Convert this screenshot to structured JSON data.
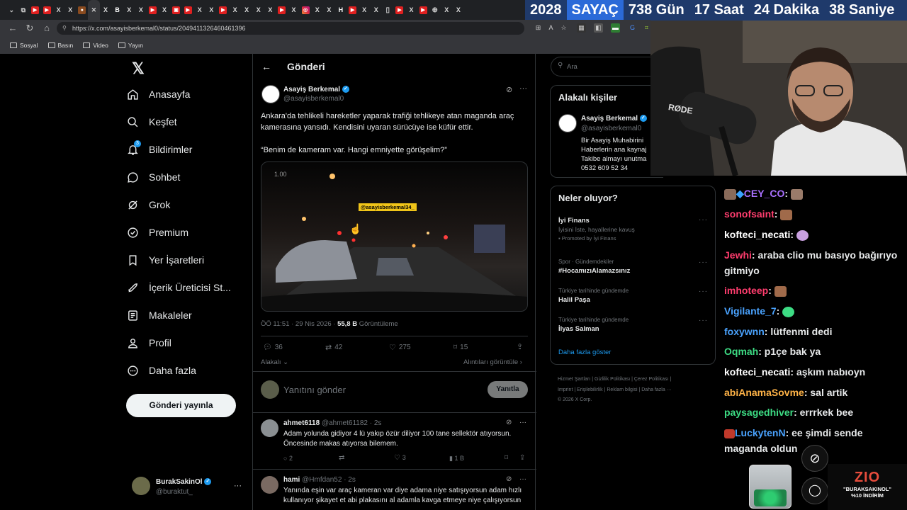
{
  "browser": {
    "url": "https://x.com/asayisberkemal0/status/2049411326460461396",
    "bookmarks": [
      "Sosyal",
      "Basın",
      "Video",
      "Yayın"
    ]
  },
  "counter": {
    "year": "2028",
    "label": "SAYAÇ",
    "days": "738 Gün",
    "hours": "17 Saat",
    "minutes": "24 Dakika",
    "seconds": "38 Saniye"
  },
  "sidebar": {
    "items": [
      {
        "label": "Anasayfa",
        "icon": "home-icon"
      },
      {
        "label": "Keşfet",
        "icon": "search-icon"
      },
      {
        "label": "Bildirimler",
        "icon": "bell-icon",
        "badge": "3"
      },
      {
        "label": "Sohbet",
        "icon": "chat-icon"
      },
      {
        "label": "Grok",
        "icon": "grok-icon"
      },
      {
        "label": "Premium",
        "icon": "premium-icon"
      },
      {
        "label": "Yer İşaretleri",
        "icon": "bookmark-icon"
      },
      {
        "label": "İçerik Üreticisi St...",
        "icon": "rocket-icon"
      },
      {
        "label": "Makaleler",
        "icon": "article-icon"
      },
      {
        "label": "Profil",
        "icon": "profile-icon"
      },
      {
        "label": "Daha fazla",
        "icon": "more-icon"
      }
    ],
    "post_button": "Gönderi yayınla",
    "account": {
      "name": "BurakSakinOl",
      "handle": "@buraktut_"
    }
  },
  "post": {
    "header_title": "Gönderi",
    "author": "Asayiş Berkemal",
    "handle": "@asayisberkemal0",
    "text1": "Ankara'da tehlikeli hareketler yaparak trafiği tehlikeye atan maganda araç kamerasına yansıdı. Kendisini uyaran sürücüye ise küfür ettir.",
    "text2": "“Benim de kameram var. Hangi emniyette görüşelim?”",
    "video_timestamp": "1.00",
    "video_watermark": "@asayisberkemal34_",
    "meta_time": "ÖÖ 11:51 · 29 Nis 2026 · ",
    "meta_views": "55,8 B",
    "meta_views_label": " Görüntüleme",
    "replies": "36",
    "reposts": "42",
    "likes": "275",
    "bookmarks": "15",
    "sort_label": "Alakalı",
    "quotes_label": "Alıntıları görüntüle",
    "reply_placeholder": "Yanıtını gönder",
    "reply_button": "Yanıtla"
  },
  "replies": [
    {
      "name": "ahmet6118",
      "handle": "@ahmet61182 · 2s",
      "text1": "Adam yolunda gidiyor 4 lü yakıp özür diliyor 100 tane sellektör atıyorsun.",
      "text2": "Öncesinde makas atıyorsa bilemem.",
      "replies": "2",
      "likes": "3",
      "views": "1 B"
    },
    {
      "name": "hami",
      "handle": "@Hmfdan52 · 2s",
      "text1": "Yanında eşin var araç kameran var diye adama niye satışıyorsun adam hızlı",
      "text2": "kullanıyor şikayet et abi plakasını al adamla kavga etmeye niye çalışıyorsun"
    }
  ],
  "right": {
    "search_placeholder": "Ara",
    "related_title": "Alakalı kişiler",
    "related": {
      "name": "Asayiş Berkemal",
      "handle": "@asayisberkemal0",
      "bio1": "Bir Asayiş Muhabirini",
      "bio2": "Haberlerin ana kaynaj",
      "bio3": "Takibe almayı unutma",
      "bio4": "0532 609 52 34"
    },
    "trends_title": "Neler oluyor?",
    "trends": [
      {
        "name": "İyi Finans",
        "sub": "İyisini İste, hayallerine kavuş",
        "promo": "Promoted by İyi Finans"
      },
      {
        "cat": "Spor · Gündemdekiler",
        "name": "#HocamızıAlamazsınız"
      },
      {
        "cat": "Türkiye tarihinde gündemde",
        "name": "Halil Paşa"
      },
      {
        "cat": "Türkiye tarihinde gündemde",
        "name": "İlyas Salman"
      }
    ],
    "show_more": "Daha fazla göster",
    "footer1": "Hizmet Şartları  |  Gizlilik Politikası  |  Çerez Politikası  |",
    "footer2": "Imprint  |  Erişilebilirlik  |  Reklam bilgisi  |  Daha fazla ···",
    "footer3": "© 2026 X Corp."
  },
  "webcam": {
    "mic_brand": "RØDE"
  },
  "chat": [
    {
      "user": "CEY_CO",
      "msg": "",
      "color": "#a970ff"
    },
    {
      "user": "sonofsaint",
      "msg": "",
      "color": "#ff3d6e"
    },
    {
      "user": "kofteci_necati",
      "msg": "",
      "color": "#ffffff"
    },
    {
      "user": "Jewhi",
      "msg": "araba clio mu basıyo bağırıyo gitmiyo",
      "color": "#ff3d6e"
    },
    {
      "user": "imhoteep",
      "msg": "",
      "color": "#ff3d6e"
    },
    {
      "user": "Vigilante_7",
      "msg": "",
      "color": "#4aa3ff"
    },
    {
      "user": "foxywnn",
      "msg": "lütfenmi dedi",
      "color": "#4aa3ff"
    },
    {
      "user": "Oqmah",
      "msg": "p1çe bak ya",
      "color": "#3ddc84"
    },
    {
      "user": "kofteci_necati",
      "msg": "aşkım nabıoyn",
      "color": "#ffffff"
    },
    {
      "user": "abiAnamaSovme",
      "msg": "sal artik",
      "color": "#ffb347"
    },
    {
      "user": "paysagedhiver",
      "msg": "errrkek bee",
      "color": "#3ddc84"
    },
    {
      "user": "LuckytenN",
      "msg": "ee şimdi sende maganda oldun",
      "color": "#4aa3ff"
    }
  ],
  "overlay": {
    "brand": "ZIO",
    "promo1": "\"BURAKSAKINOL\"",
    "promo2": "%10 İNDİRİM"
  }
}
